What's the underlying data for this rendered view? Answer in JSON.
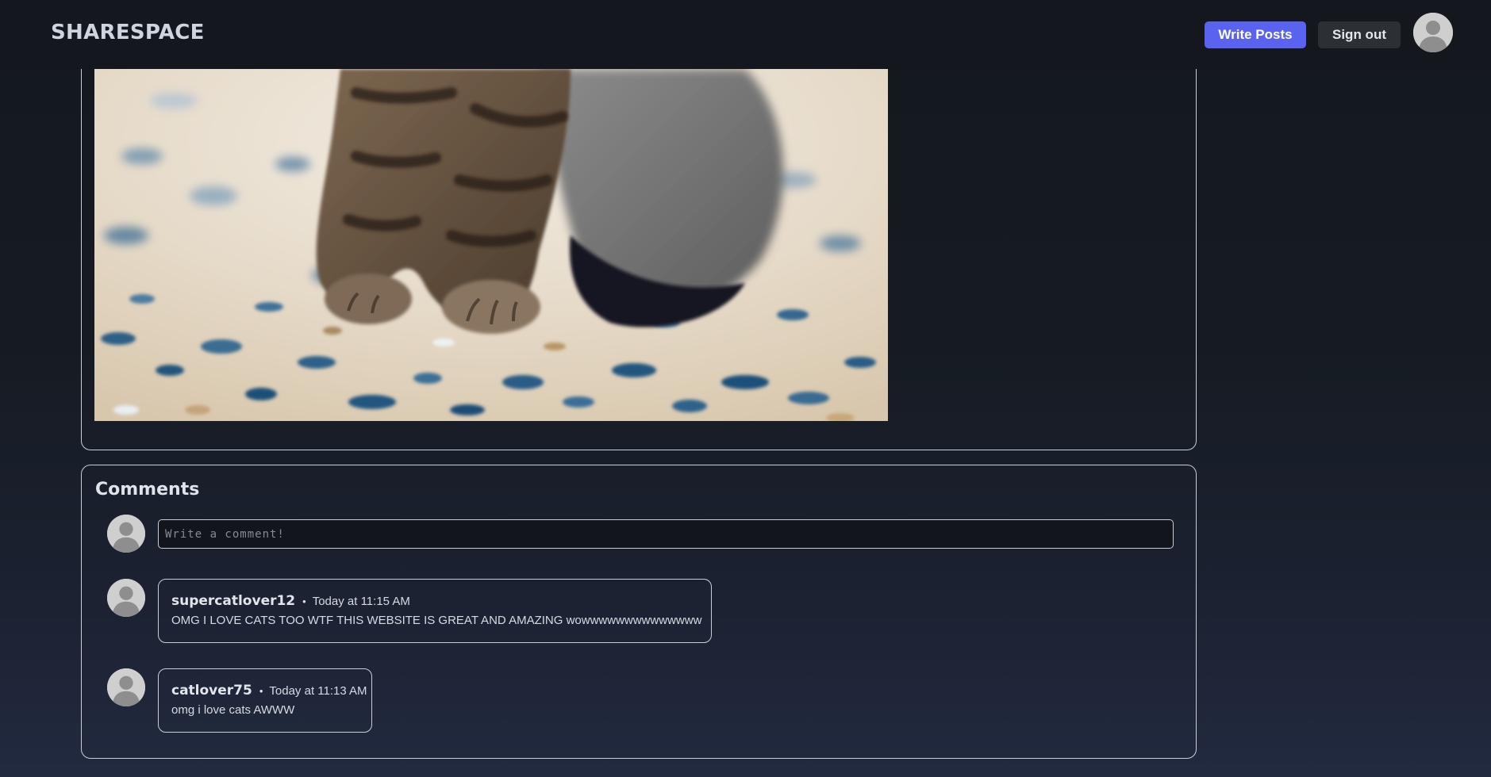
{
  "header": {
    "brand": "SHARESPACE",
    "write_posts_label": "Write Posts",
    "sign_out_label": "Sign out",
    "user_avatar_icon": "user-avatar-icon"
  },
  "post": {
    "image_icon": "cat-paws-photo"
  },
  "comments": {
    "title": "Comments",
    "input_placeholder": "Write a comment!",
    "input_value": "",
    "items": [
      {
        "author": "supercatlover12",
        "time": "Today at 11:15 AM",
        "text": "OMG I LOVE CATS TOO WTF THIS WEBSITE IS GREAT AND AMAZING wowwwwwwwwwwwwww"
      },
      {
        "author": "catlover75",
        "time": "Today at 11:13 AM",
        "text": "omg i love cats AWWW"
      }
    ]
  },
  "colors": {
    "background": "#14181e",
    "accent_button": "#5a63f0",
    "secondary_button": "#2c3035",
    "card_border": "#c9ced6"
  }
}
